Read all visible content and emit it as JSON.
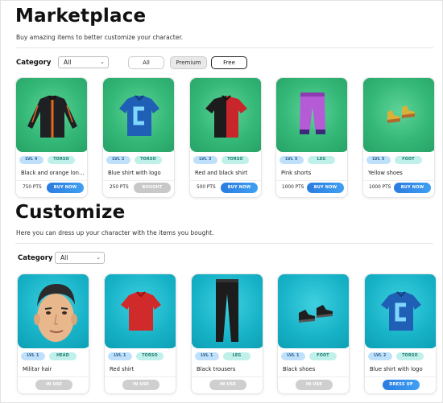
{
  "marketplace": {
    "title": "Marketplace",
    "subtitle": "Buy amazing items to better customize your character.",
    "category_label": "Category",
    "category_value": "All",
    "filters": [
      "All",
      "Premium",
      "Free"
    ],
    "items": [
      {
        "level": "LVL 4",
        "type": "TORSO",
        "name": "Black and orange long sleeve shirt",
        "price": "750 PTS",
        "button": "BUY NOW",
        "icon": "long-sleeve-shirt-icon"
      },
      {
        "level": "LVL 2",
        "type": "TORSO",
        "name": "Blue shirt with logo",
        "price": "250 PTS",
        "button": "BOUGHT",
        "icon": "blue-shirt-icon"
      },
      {
        "level": "LVL 3",
        "type": "TORSO",
        "name": "Red and black shirt",
        "price": "500 PTS",
        "button": "BUY NOW",
        "icon": "red-black-shirt-icon"
      },
      {
        "level": "LVL 5",
        "type": "LEG",
        "name": "Pink shorts",
        "price": "1000 PTS",
        "button": "BUY NOW",
        "icon": "pink-pants-icon"
      },
      {
        "level": "LVL 5",
        "type": "FOOT",
        "name": "Yellow shoes",
        "price": "1000 PTS",
        "button": "BUY NOW",
        "icon": "yellow-shoes-icon"
      }
    ]
  },
  "customize": {
    "title": "Customize",
    "subtitle": "Here you can dress up your character with the items you bought.",
    "category_label": "Category",
    "category_value": "All",
    "items": [
      {
        "level": "LVL 1",
        "type": "HEAD",
        "name": "Militar hair",
        "button": "IN USE",
        "icon": "character-head-icon"
      },
      {
        "level": "LVL 1",
        "type": "TORSO",
        "name": "Red shirt",
        "button": "IN USE",
        "icon": "red-shirt-icon"
      },
      {
        "level": "LVL 1",
        "type": "LEG",
        "name": "Black trousers",
        "button": "IN USE",
        "icon": "black-trousers-icon"
      },
      {
        "level": "LVL 1",
        "type": "FOOT",
        "name": "Black shoes",
        "button": "IN USE",
        "icon": "black-shoes-icon"
      },
      {
        "level": "LVL 2",
        "type": "TORSO",
        "name": "Blue shirt with logo",
        "button": "DRESS UP",
        "icon": "blue-shirt-icon"
      }
    ]
  }
}
